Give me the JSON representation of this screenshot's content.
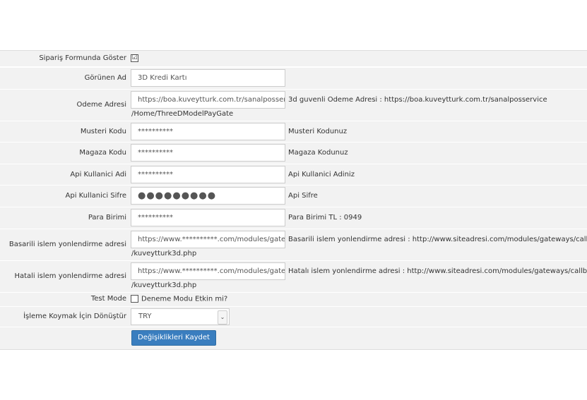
{
  "form": {
    "show_on_order_form": {
      "label": "Sipariş Formunda Göster",
      "checked": "☑"
    },
    "display_name": {
      "label": "Görünen Ad",
      "value": "3D Kredi Kartı"
    },
    "payment_url": {
      "label": "Odeme Adresi",
      "value": "https://boa.kuveytturk.com.tr/sanalposservice",
      "help": "3d guvenli Odeme Adresi : https://boa.kuveytturk.com.tr/sanalposservice",
      "continuation": "/Home/ThreeDModelPayGate"
    },
    "customer_code": {
      "label": "Musteri Kodu",
      "value": "**********",
      "help": "Musteri Kodunuz"
    },
    "store_code": {
      "label": "Magaza Kodu",
      "value": "**********",
      "help": "Magaza Kodunuz"
    },
    "api_user": {
      "label": "Api Kullanici Adi",
      "value": "**********",
      "help": "Api Kullanici Adiniz"
    },
    "api_password": {
      "label": "Api Kullanici Sifre",
      "value": "●●●●●●●●●",
      "help": "Api Sifre"
    },
    "currency": {
      "label": "Para Birimi",
      "value": "**********",
      "help": "Para Birimi TL : 0949"
    },
    "success_redirect": {
      "label": "Basarili islem yonlendirme adresi",
      "value": "https://www.**********.com/modules/gateways",
      "help": "Basarili islem yonlendirme adresi : http://www.siteadresi.com/modules/gateways/callback",
      "continuation": "/kuveytturk3d.php"
    },
    "fail_redirect": {
      "label": "Hatali islem yonlendirme adresi",
      "value": "https://www.**********.com/modules/gateways",
      "help": "Hatalı islem yonlendirme adresi : http://www.siteadresi.com/modules/gateways/callback",
      "continuation": "/kuveytturk3d.php"
    },
    "test_mode": {
      "label": "Test Mode",
      "checkbox_label": "Deneme Modu Etkin mi?"
    },
    "convert_currency": {
      "label": "İşleme Koymak İçin Dönüştür",
      "selected": "TRY"
    },
    "save_label": "Değişiklikleri Kaydet"
  }
}
